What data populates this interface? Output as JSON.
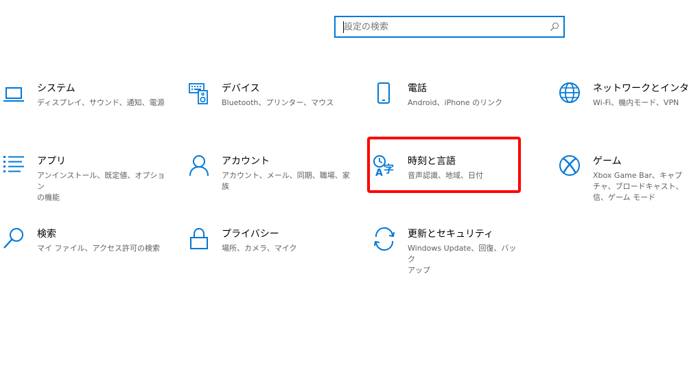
{
  "search": {
    "placeholder": "設定の検索"
  },
  "tiles": [
    {
      "title": "システム",
      "desc": "ディスプレイ、サウンド、通知、電源"
    },
    {
      "title": "デバイス",
      "desc": "Bluetooth、プリンター、マウス"
    },
    {
      "title": "電話",
      "desc": "Android、iPhone のリンク"
    },
    {
      "title": "ネットワークとインターネット",
      "desc": "Wi-Fi、機内モード、VPN"
    },
    {
      "title": "アプリ",
      "desc_lines": [
        "アンインストール、既定値、オプション",
        "の機能"
      ]
    },
    {
      "title": "アカウント",
      "desc_lines": [
        "アカウント、メール、同期、職場、家",
        "族"
      ]
    },
    {
      "title": "時刻と言語",
      "desc": "音声認識、地域、日付"
    },
    {
      "title": "ゲーム",
      "desc_lines": [
        "Xbox Game Bar、キャプチャ、ブロードキャスト、",
        "信、ゲーム モード"
      ]
    },
    {
      "title": "検索",
      "desc": "マイ ファイル、アクセス許可の検索"
    },
    {
      "title": "プライバシー",
      "desc": "場所、カメラ、マイク"
    },
    {
      "title": "更新とセキュリティ",
      "desc_lines": [
        "Windows Update、回復、バック",
        "アップ"
      ]
    }
  ],
  "highlight": {
    "target": "時刻と言語"
  },
  "colors": {
    "accent": "#0078d7",
    "highlight": "#ff0000",
    "desc_text": "#5f5f5f"
  }
}
